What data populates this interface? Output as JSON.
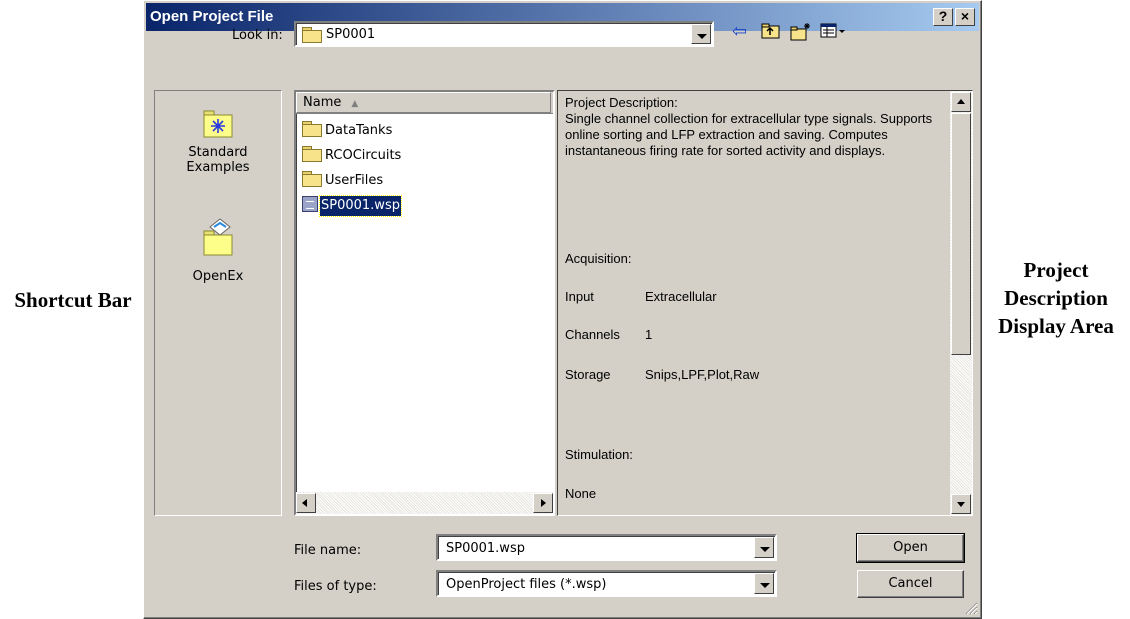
{
  "callouts": {
    "left": "Shortcut Bar",
    "right": "Project Description Display Area"
  },
  "dialog": {
    "title": "Open Project File",
    "help_button": "?",
    "close_button": "×",
    "look_in": {
      "label": "Look in:",
      "value": "SP0001"
    },
    "toolbar": {
      "icons": [
        "back-arrow-icon",
        "up-folder-icon",
        "new-folder-icon",
        "view-menu-icon"
      ]
    },
    "shortcut_bar": {
      "items": [
        {
          "label_line1": "Standard",
          "label_line2": "Examples",
          "icon": "standard-examples-folder-icon"
        },
        {
          "label_line1": "OpenEx",
          "label_line2": "",
          "icon": "openex-folder-icon"
        }
      ]
    },
    "file_list": {
      "column_header": "Name",
      "items": [
        {
          "name": "DataTanks",
          "type": "folder",
          "selected": false
        },
        {
          "name": "RCOCircuits",
          "type": "folder",
          "selected": false
        },
        {
          "name": "UserFiles",
          "type": "folder",
          "selected": false
        },
        {
          "name": "SP0001.wsp",
          "type": "wsp-file",
          "selected": true
        }
      ]
    },
    "description": {
      "heading": "Project Description:",
      "body": "Single channel collection for extracellular type signals.  Supports online sorting and LFP extraction and saving.  Computes instantaneous firing rate for sorted activity and displays.",
      "acquisition_label": "Acquisition:",
      "input_key": "Input",
      "input_value": "Extracellular",
      "channels_key": "Channels",
      "channels_value": "1",
      "storage_key": "Storage",
      "storage_value": "Snips,LPF,Plot,Raw",
      "stimulation_label": "Stimulation:",
      "stimulation_value": "None"
    },
    "file_name": {
      "label": "File name:",
      "value": "SP0001.wsp"
    },
    "files_of_type": {
      "label": "Files of type:",
      "value": "OpenProject files (*.wsp)"
    },
    "buttons": {
      "open": "Open",
      "cancel": "Cancel"
    }
  }
}
